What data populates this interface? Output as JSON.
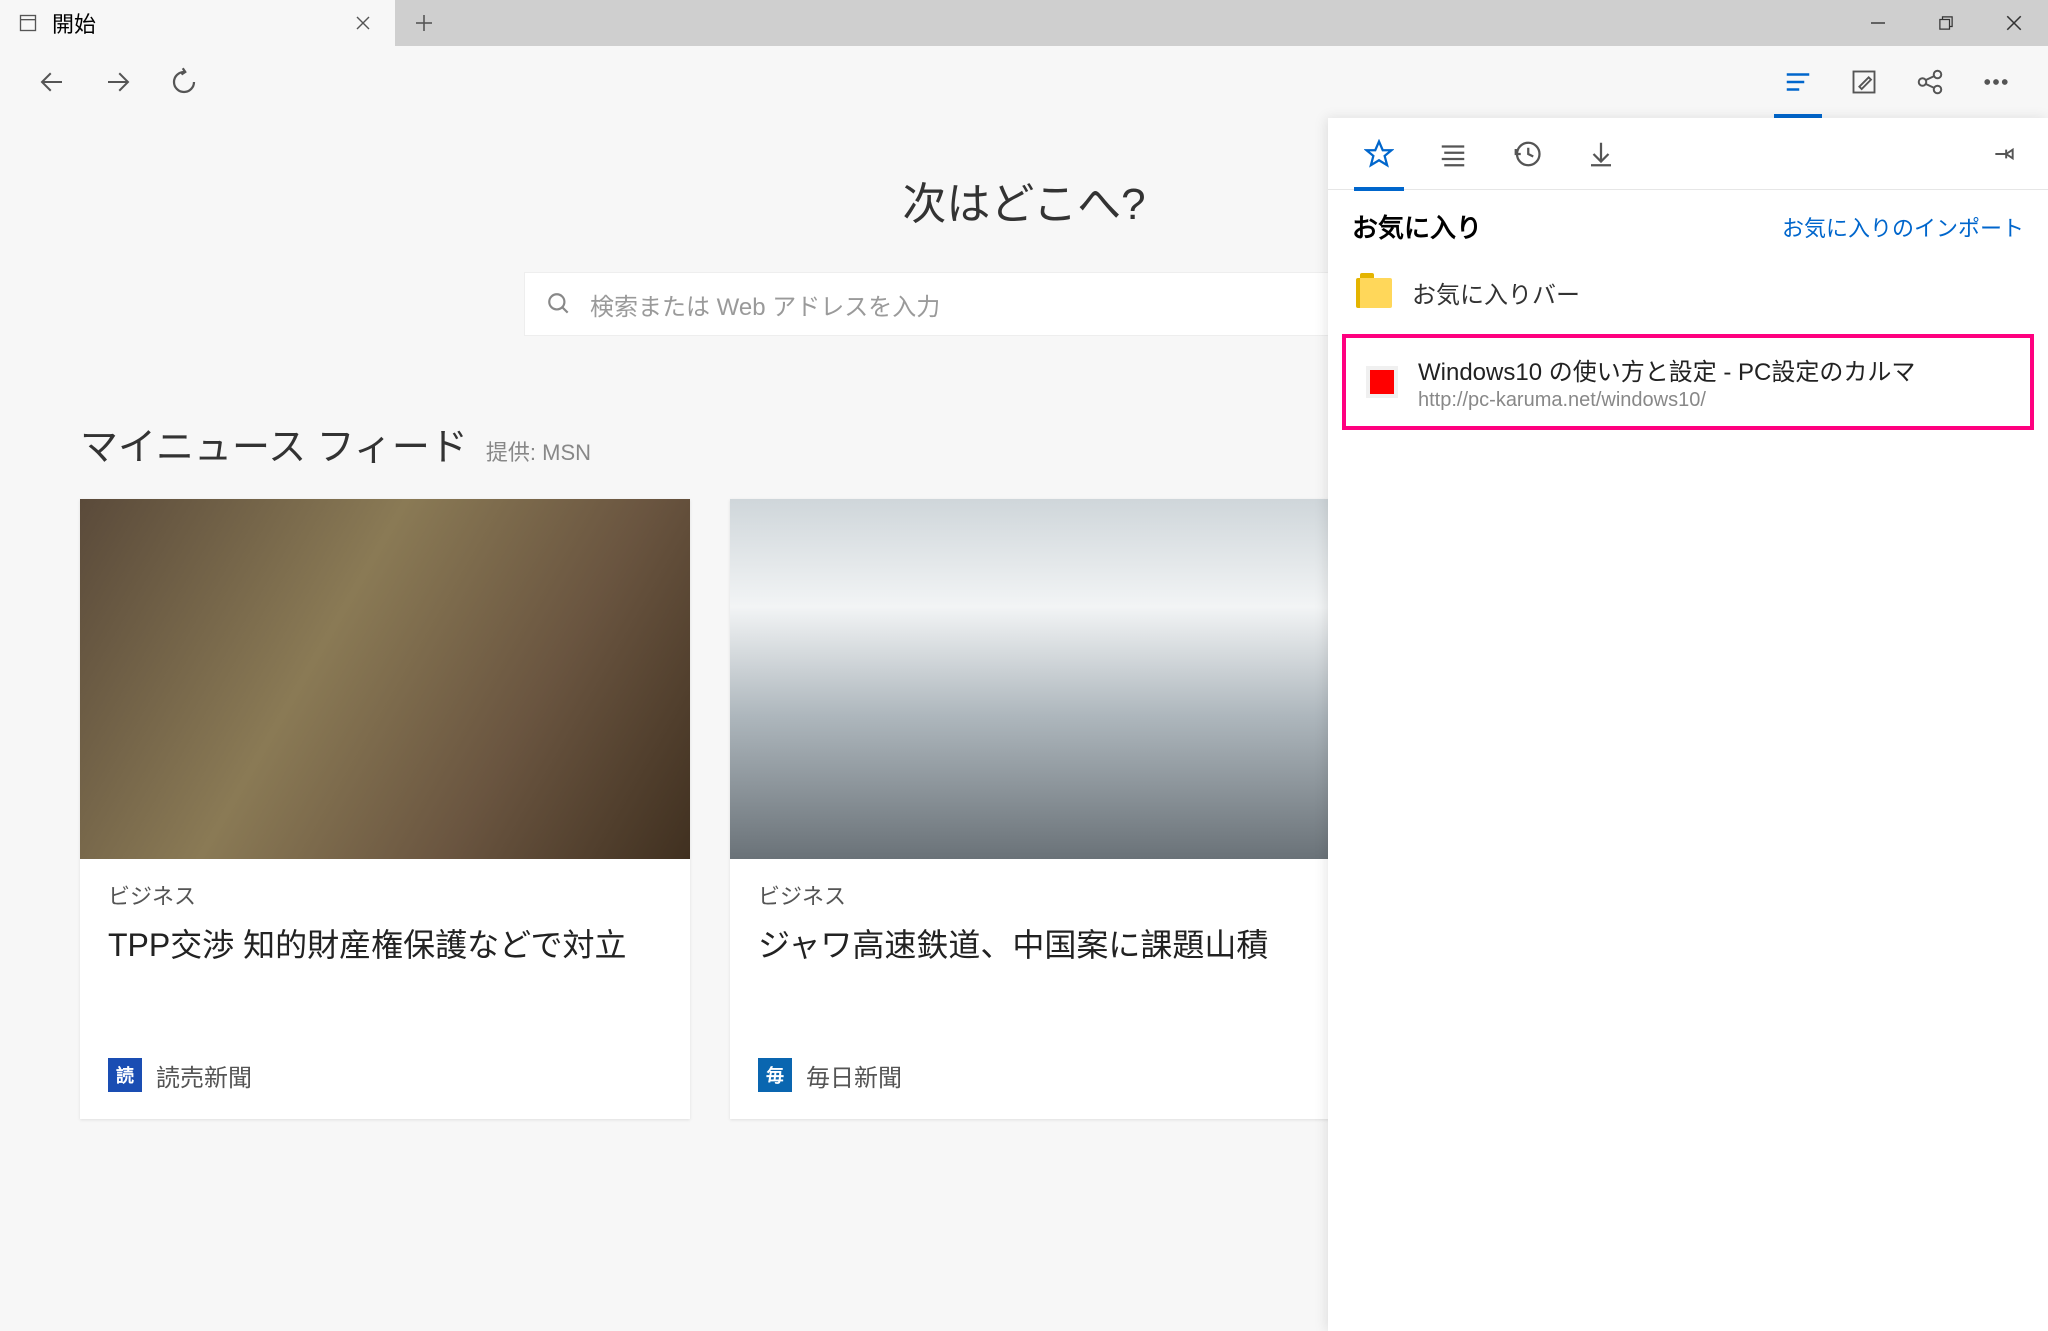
{
  "tab": {
    "title": "開始"
  },
  "start": {
    "heading": "次はどこへ?",
    "search_placeholder": "検索または Web アドレスを入力",
    "feed_title": "マイニュース フィード",
    "feed_sub": "提供: MSN"
  },
  "cards": [
    {
      "category": "ビジネス",
      "headline": "TPP交渉 知的財産権保護などで対立",
      "source": "読売新聞",
      "source_badge": "読",
      "badge_color": "#1a4db3"
    },
    {
      "category": "ビジネス",
      "headline": "ジャワ高速鉄道、中国案に課題山積",
      "source": "毎日新聞",
      "source_badge": "毎",
      "badge_color": "#0a66b0"
    }
  ],
  "hub": {
    "title": "お気に入り",
    "import_label": "お気に入りのインポート",
    "folder_label": "お気に入りバー",
    "entry": {
      "name": "Windows10 の使い方と設定 - PC設定のカルマ",
      "url": "http://pc-karuma.net/windows10/"
    }
  }
}
